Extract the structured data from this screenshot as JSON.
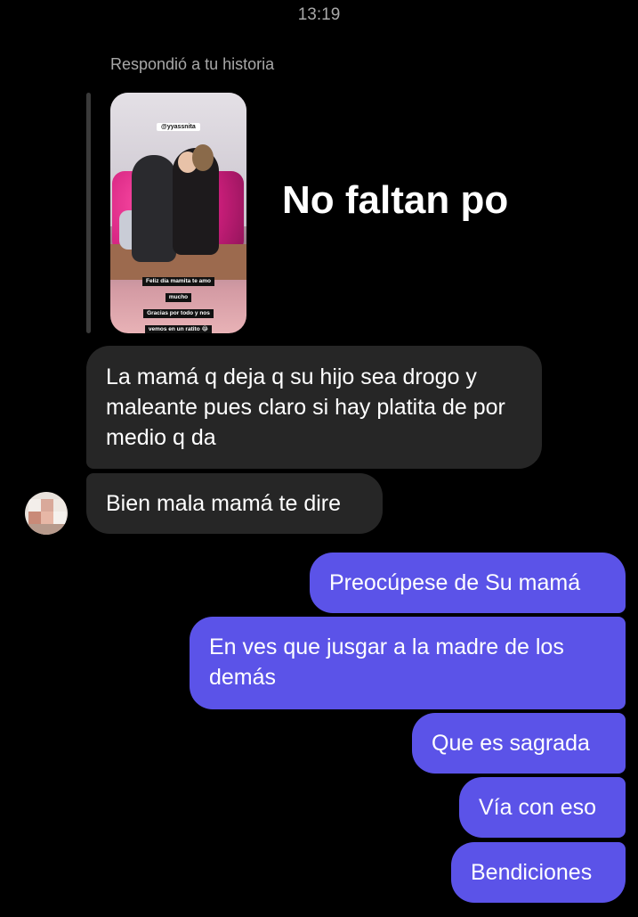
{
  "status": {
    "time": "13:19"
  },
  "story_reply": {
    "label": "Respondió a tu historia",
    "username_tag": "@yyassnita",
    "caption_lines": [
      "Feliz día mamita te amo",
      "mucho",
      "Gracias por todo y nos",
      "vemos en un ratito 😂"
    ],
    "reply_text": "No faltan po"
  },
  "messages": [
    {
      "direction": "incoming",
      "text": "La mamá q deja q su hijo sea drogo y maleante pues claro si hay platita de por medio q da"
    },
    {
      "direction": "incoming",
      "text": "Bien mala mamá te dire"
    },
    {
      "direction": "outgoing",
      "text": "Preocúpese de Su mamá"
    },
    {
      "direction": "outgoing",
      "text": "En ves que jusgar a la madre de los demás"
    },
    {
      "direction": "outgoing",
      "text": "Que es sagrada"
    },
    {
      "direction": "outgoing",
      "text": "Vía con eso"
    },
    {
      "direction": "outgoing",
      "text": "Bendiciones"
    }
  ],
  "colors": {
    "background": "#000000",
    "incoming_bubble": "#262626",
    "outgoing_bubble": "#5b53e8",
    "meta_text": "#a8a8a8"
  }
}
